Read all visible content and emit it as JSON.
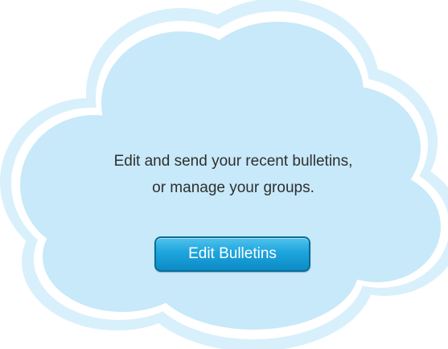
{
  "cloud": {
    "message_line1": "Edit and send your recent bulletins,",
    "message_line2": "or manage your groups.",
    "button_label": "Edit Bulletins"
  },
  "colors": {
    "cloud_fill": "#c7e9f9",
    "cloud_rim": "#d8f0fb",
    "cloud_outline": "#ffffff",
    "button_top": "#4fc3ec",
    "button_bottom": "#0b8bc7",
    "button_border": "#0a6d98",
    "text": "#2f2f2f"
  }
}
